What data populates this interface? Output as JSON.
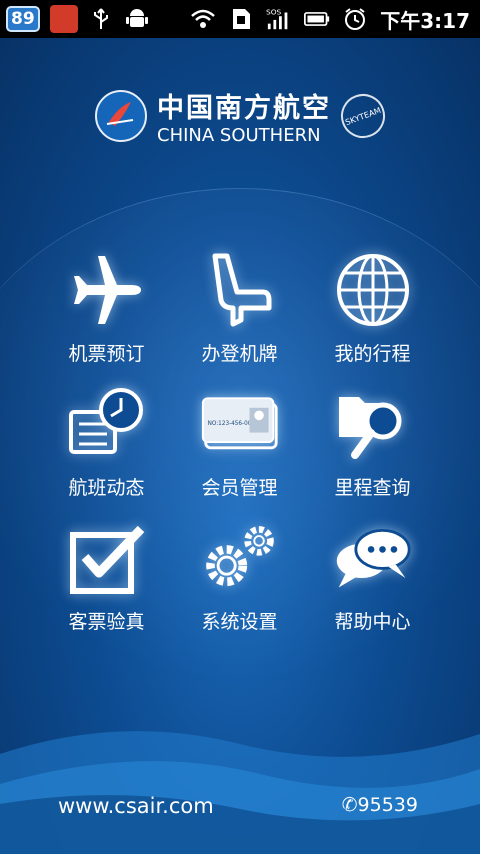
{
  "status_bar": {
    "notification_count": "89",
    "time": "下午3:17"
  },
  "brand": {
    "name_cn": "中国南方航空",
    "name_en": "CHINA SOUTHERN",
    "alliance": "SKYTEAM"
  },
  "menu": [
    {
      "label": "机票预订",
      "icon": "airplane-icon"
    },
    {
      "label": "办登机牌",
      "icon": "seat-icon"
    },
    {
      "label": "我的行程",
      "icon": "globe-icon"
    },
    {
      "label": "航班动态",
      "icon": "flight-clock-icon"
    },
    {
      "label": "会员管理",
      "icon": "member-card-icon"
    },
    {
      "label": "里程查询",
      "icon": "folder-search-icon"
    },
    {
      "label": "客票验真",
      "icon": "checkbox-icon"
    },
    {
      "label": "系统设置",
      "icon": "gears-icon"
    },
    {
      "label": "帮助中心",
      "icon": "chat-bubbles-icon"
    }
  ],
  "member_card_text": "NO:123-456-00",
  "footer": {
    "website": "www.csair.com",
    "phone": "95539"
  },
  "colors": {
    "background_dark": "#073266",
    "background_mid": "#0d4c92",
    "accent": "#1c6cbc",
    "icon": "#ffffff"
  }
}
